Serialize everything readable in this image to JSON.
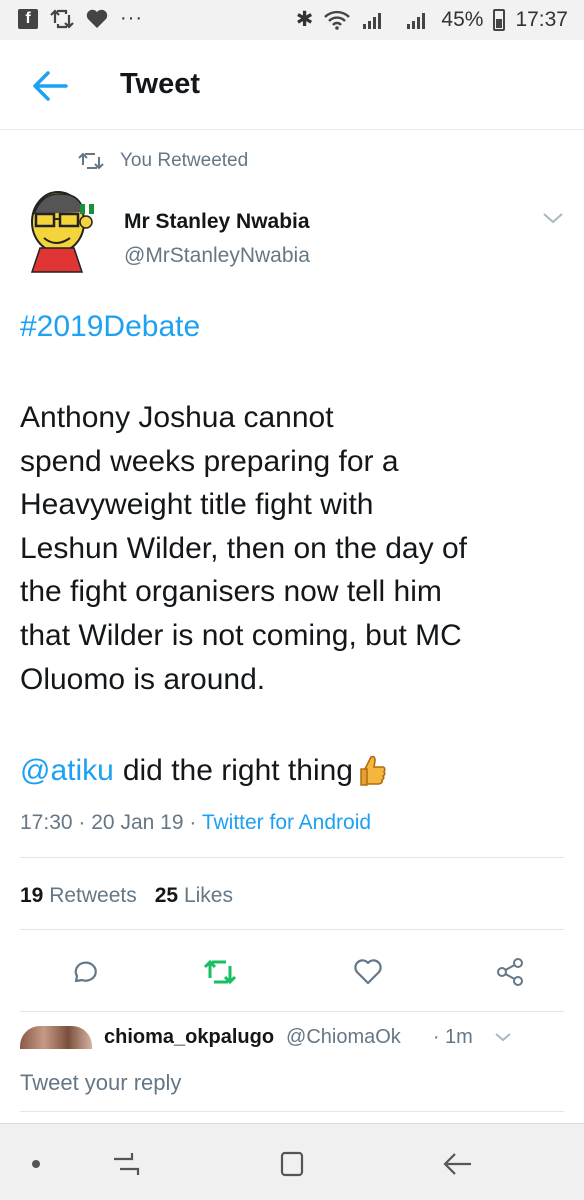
{
  "status_bar": {
    "battery": "45%",
    "time": "17:37",
    "left_icons": [
      "facebook-icon",
      "retweet-icon",
      "heart-icon",
      "more-dots-icon"
    ],
    "right_icons": [
      "bluetooth-icon",
      "wifi-icon",
      "signal-icon",
      "signal-icon",
      "battery-icon"
    ]
  },
  "header": {
    "title": "Tweet"
  },
  "retweet_context": "You Retweeted",
  "tweet": {
    "name": "Mr Stanley Nwabia",
    "handle": "@MrStanleyNwabia",
    "hashtag": "#2019Debate",
    "body": "Anthony Joshua cannot\nspend weeks preparing for a\nHeavyweight title fight with\nLeshun Wilder, then on the day of\nthe fight organisers now tell him\nthat Wilder is not coming, but MC\nOluomo is around.",
    "mention": "@atiku",
    "mention_text": "did the right thing",
    "time": "17:30",
    "date": "20 Jan 19",
    "separator": "·",
    "client": "Twitter for Android",
    "retweets_count": "19",
    "retweets_label": "Retweets",
    "likes_count": "25",
    "likes_label": "Likes"
  },
  "reply_preview": {
    "name": "chioma_okpalugo",
    "handle": "@ChiomaOk",
    "time": "· 1m"
  },
  "reply_input": {
    "placeholder": "Tweet your reply"
  },
  "colors": {
    "accent": "#1da1f2",
    "retweet_green": "#17bf63",
    "muted": "#657786",
    "text": "#14171a"
  }
}
